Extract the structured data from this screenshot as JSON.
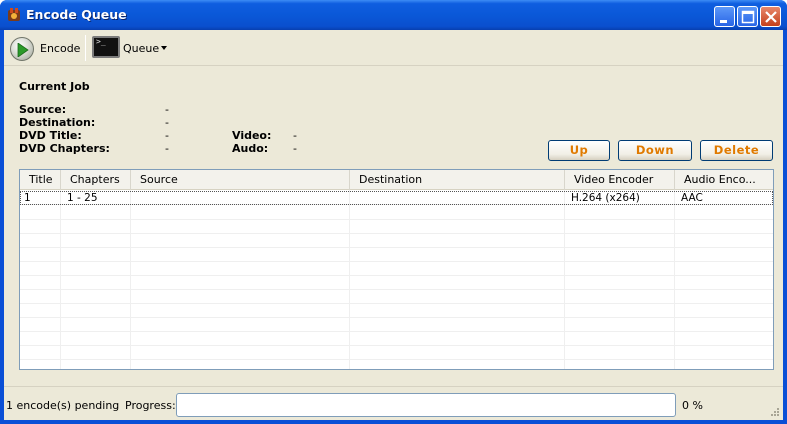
{
  "window": {
    "title": "Encode Queue"
  },
  "toolbar": {
    "encode_label": "Encode",
    "queue_label": "Queue"
  },
  "current_job": {
    "heading": "Current Job",
    "source_label": "Source:",
    "source_value": "-",
    "destination_label": "Destination:",
    "destination_value": "-",
    "dvd_title_label": "DVD Title:",
    "dvd_title_value": "-",
    "dvd_chapters_label": "DVD Chapters:",
    "dvd_chapters_value": "-",
    "video_label": "Video:",
    "video_value": "-",
    "audio_label": "Audo:",
    "audio_value": "-"
  },
  "buttons": {
    "up": "Up",
    "down": "Down",
    "delete": "Delete"
  },
  "table": {
    "columns": [
      "Title",
      "Chapters",
      "Source",
      "Destination",
      "Video Encoder",
      "Audio Enco..."
    ],
    "rows": [
      [
        "1",
        "1 - 25",
        "",
        "",
        "H.264 (x264)",
        "AAC"
      ]
    ]
  },
  "status": {
    "pending": "1 encode(s) pending",
    "progress_label": "Progress:",
    "progress_percent_text": "0 %",
    "progress_value": 0
  },
  "colors": {
    "title_bar": "#0a58d8",
    "button_text": "#e07a00",
    "window_bg": "#ece9d8"
  }
}
